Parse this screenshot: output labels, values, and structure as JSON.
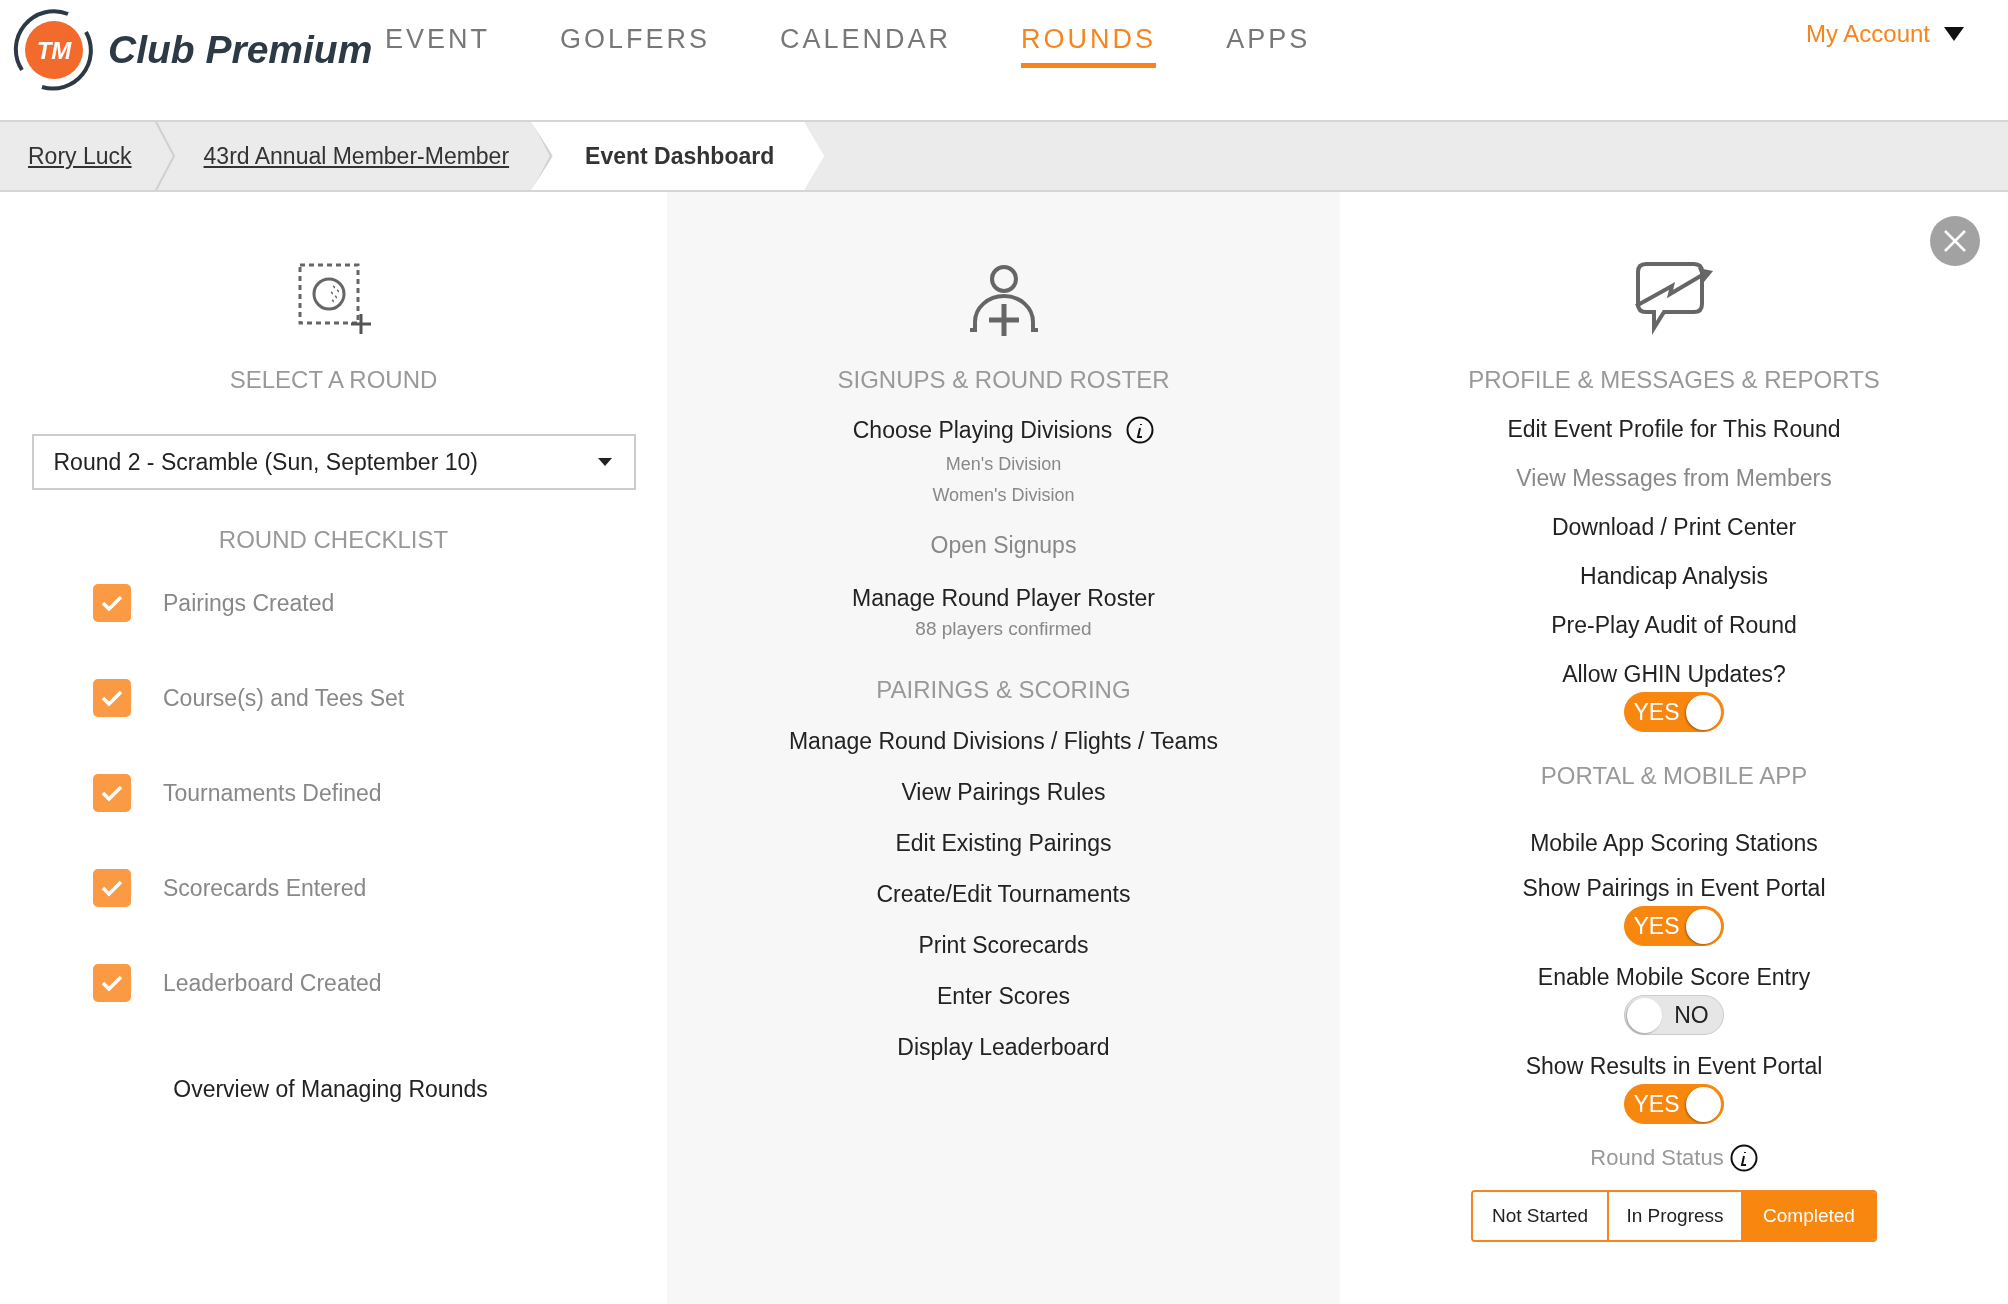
{
  "header": {
    "logo_badge": "TM",
    "logo_text": "Club Premium",
    "nav": [
      {
        "label": "EVENT",
        "selected": false
      },
      {
        "label": "GOLFERS",
        "selected": false
      },
      {
        "label": "CALENDAR",
        "selected": false
      },
      {
        "label": "ROUNDS",
        "selected": true
      },
      {
        "label": "APPS",
        "selected": false
      }
    ],
    "account": "My Account"
  },
  "breadcrumbs": [
    {
      "label": "Rory Luck",
      "current": false
    },
    {
      "label": "43rd Annual Member-Member",
      "current": false
    },
    {
      "label": "Event Dashboard",
      "current": true
    }
  ],
  "left": {
    "heading": "SELECT A ROUND",
    "round_select": {
      "value": "Round 2 - Scramble (Sun, September 10)"
    },
    "checklist_heading": "ROUND CHECKLIST",
    "checklist": [
      {
        "label": "Pairings Created",
        "checked": true
      },
      {
        "label": "Course(s) and Tees Set",
        "checked": true
      },
      {
        "label": "Tournaments Defined",
        "checked": true
      },
      {
        "label": "Scorecards Entered",
        "checked": true
      },
      {
        "label": "Leaderboard Created",
        "checked": true
      }
    ],
    "overview_link": "Overview of Managing Rounds"
  },
  "middle": {
    "sections": [
      {
        "heading": "SIGNUPS & ROUND ROSTER",
        "items": [
          {
            "label": "Choose Playing Divisions",
            "disabled": false,
            "info": true,
            "sub": [
              "Men's Division",
              "Women's Division"
            ]
          },
          {
            "label": "Open Signups",
            "disabled": true
          },
          {
            "label": "Manage Round Player Roster",
            "disabled": false,
            "note": "88 players confirmed"
          }
        ]
      },
      {
        "heading": "PAIRINGS & SCORING",
        "items": [
          {
            "label": "Manage Round Divisions / Flights / Teams",
            "disabled": false
          },
          {
            "label": "View Pairings Rules",
            "disabled": false
          },
          {
            "label": "Edit Existing Pairings",
            "disabled": false
          },
          {
            "label": "Create/Edit Tournaments",
            "disabled": false
          },
          {
            "label": "Print Scorecards",
            "disabled": false
          },
          {
            "label": "Enter Scores",
            "disabled": false
          },
          {
            "label": "Display Leaderboard",
            "disabled": false
          }
        ]
      }
    ]
  },
  "right": {
    "sections": [
      {
        "heading": "PROFILE & MESSAGES & REPORTS",
        "items": [
          {
            "kind": "link",
            "label": "Edit Event Profile for This Round",
            "disabled": false
          },
          {
            "kind": "link",
            "label": "View Messages from Members",
            "disabled": true
          },
          {
            "kind": "link",
            "label": "Download / Print Center",
            "disabled": false
          },
          {
            "kind": "link",
            "label": "Handicap Analysis",
            "disabled": false
          },
          {
            "kind": "link",
            "label": "Pre-Play Audit of Round",
            "disabled": false
          },
          {
            "kind": "toggle",
            "label": "Allow GHIN Updates?",
            "on": true,
            "state_label": "YES"
          }
        ]
      },
      {
        "heading": "PORTAL & MOBILE APP",
        "items": [
          {
            "kind": "link",
            "label": "Mobile App Scoring Stations",
            "disabled": false
          },
          {
            "kind": "toggle",
            "label": "Show Pairings in Event Portal",
            "on": true,
            "state_label": "YES"
          },
          {
            "kind": "toggle",
            "label": "Enable Mobile Score Entry",
            "on": false,
            "state_label": "NO"
          },
          {
            "kind": "toggle",
            "label": "Show Results in Event Portal",
            "on": true,
            "state_label": "YES"
          }
        ]
      }
    ],
    "round_status": {
      "label": "Round Status",
      "info": true,
      "options": [
        {
          "label": "Not Started",
          "selected": false
        },
        {
          "label": "In Progress",
          "selected": false
        },
        {
          "label": "Completed",
          "selected": true
        }
      ]
    }
  }
}
